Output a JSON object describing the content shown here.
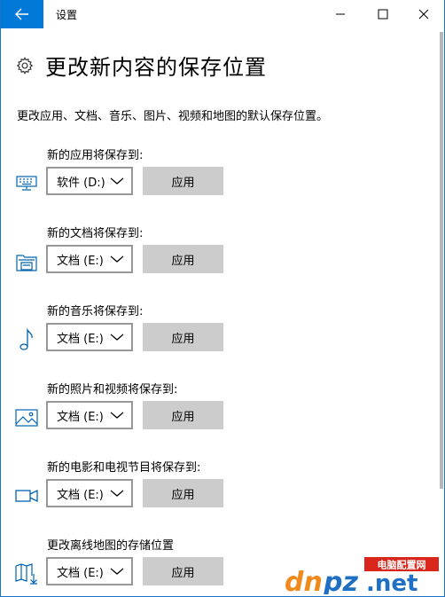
{
  "window": {
    "title": "设置"
  },
  "page": {
    "title": "更改新内容的保存位置",
    "description": "更改应用、文档、音乐、图片、视频和地图的默认保存位置。"
  },
  "sections": [
    {
      "label": "新的应用将保存到:",
      "icon": "monitor-icon",
      "value": "软件 (D:)",
      "apply": "应用"
    },
    {
      "label": "新的文档将保存到:",
      "icon": "folder-drive-icon",
      "value": "文档 (E:)",
      "apply": "应用"
    },
    {
      "label": "新的音乐将保存到:",
      "icon": "music-note-icon",
      "value": "文档 (E:)",
      "apply": "应用"
    },
    {
      "label": "新的照片和视频将保存到:",
      "icon": "picture-icon",
      "value": "文档 (E:)",
      "apply": "应用"
    },
    {
      "label": "新的电影和电视节目将保存到:",
      "icon": "video-camera-icon",
      "value": "文档 (E:)",
      "apply": "应用"
    },
    {
      "label": "更改离线地图的存储位置",
      "icon": "map-download-icon",
      "value": "文档 (E:)",
      "apply": "应用"
    }
  ],
  "watermark": {
    "text": "dnpz.net",
    "banner": "电脑配置网"
  },
  "colors": {
    "accent": "#0078d7",
    "icon": "#0063b1",
    "button_bg": "#cccccc",
    "dropdown_border": "#999999"
  }
}
